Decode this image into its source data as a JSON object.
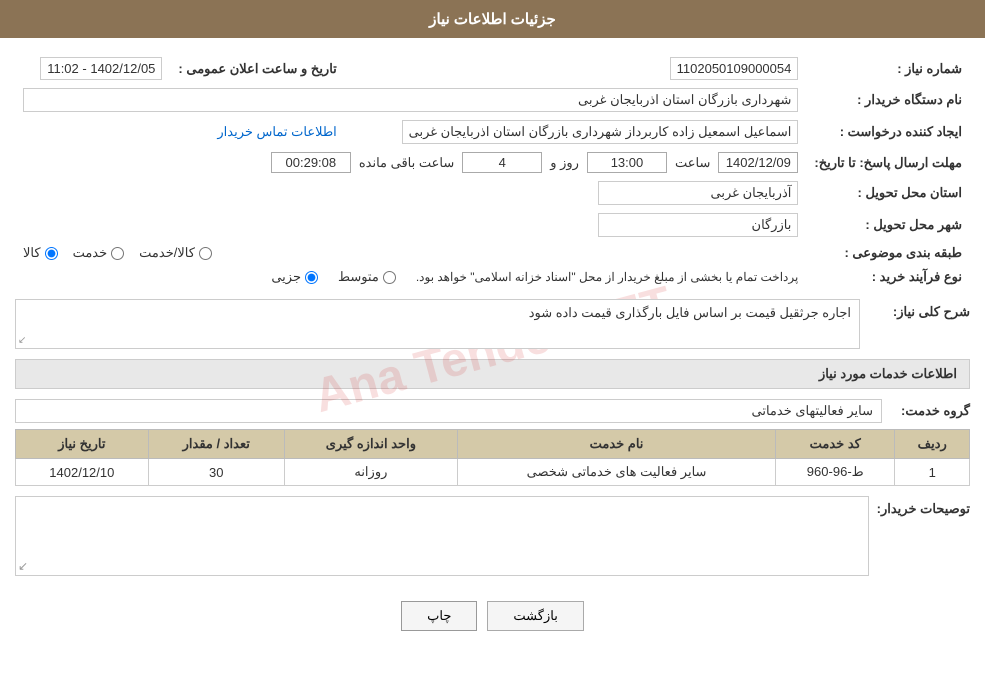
{
  "page": {
    "title": "جزئیات اطلاعات نیاز",
    "watermark": "Ana Tender.NET"
  },
  "header": {
    "title": "جزئیات اطلاعات نیاز"
  },
  "fields": {
    "shomareNiaz_label": "شماره نیاز :",
    "shomareNiaz_value": "1102050109000054",
    "namDastgah_label": "نام دستگاه خریدار :",
    "namDastgah_value": "شهرداری بازرگان استان اذربایجان غربی",
    "ijadKonande_label": "ایجاد کننده درخواست :",
    "ijadKonande_value": "اسماعیل اسمعیل زاده کاربرداز شهرداری بازرگان استان اذربایجان غربی",
    "ettelaatTamas_label": "اطلاعات تماس خریدار",
    "mohlat_label": "مهلت ارسال پاسخ: تا تاریخ:",
    "tarikhDate_value": "1402/12/09",
    "saatLabel": "ساعت",
    "saatValue": "13:00",
    "rozLabel": "روز و",
    "rozValue": "4",
    "mandeBaghiLabel": "ساعت باقی مانده",
    "mandeBaghiValue": "00:29:08",
    "ostan_label": "استان محل تحویل :",
    "ostan_value": "آذربایجان غربی",
    "shahr_label": "شهر محل تحویل :",
    "shahr_value": "بازرگان",
    "tabaqe_label": "طبقه بندی موضوعی :",
    "radio_kala": "کالا",
    "radio_khadamat": "خدمت",
    "radio_kala_khadamat": "کالا/خدمت",
    "noeFarayand_label": "نوع فرآیند خرید :",
    "radio_jozi": "جزیی",
    "radio_motavasset": "متوسط",
    "notice": "پرداخت تمام یا بخشی از مبلغ خریدار از محل \"اسناد خزانه اسلامی\" خواهد بود.",
    "tarikhVaSaat_label": "تاریخ و ساعت اعلان عمومی :",
    "tarikhVaSaat_value": "1402/12/05 - 11:02",
    "sharhKolli_label": "شرح کلی نیاز:",
    "sharhKolli_value": "اجاره جرثقیل قیمت بر اساس فایل بارگذاری قیمت داده شود",
    "khadamatSection_title": "اطلاعات خدمات مورد نیاز",
    "groupKhadamat_label": "گروه خدمت:",
    "groupKhadamat_value": "سایر فعالیتهای خدماتی",
    "table": {
      "cols": [
        "ردیف",
        "کد خدمت",
        "نام خدمت",
        "واحد اندازه گیری",
        "تعداد / مقدار",
        "تاریخ نیاز"
      ],
      "rows": [
        {
          "radif": "1",
          "kod": "ط-96-960",
          "name": "سایر فعالیت های خدماتی شخصی",
          "vahed": "روزانه",
          "tedad": "30",
          "tarikh": "1402/12/10"
        }
      ]
    },
    "tosifKharidar_label": "توصیحات خریدار:",
    "tosifKharidar_value": ""
  },
  "buttons": {
    "print": "چاپ",
    "back": "بازگشت"
  }
}
